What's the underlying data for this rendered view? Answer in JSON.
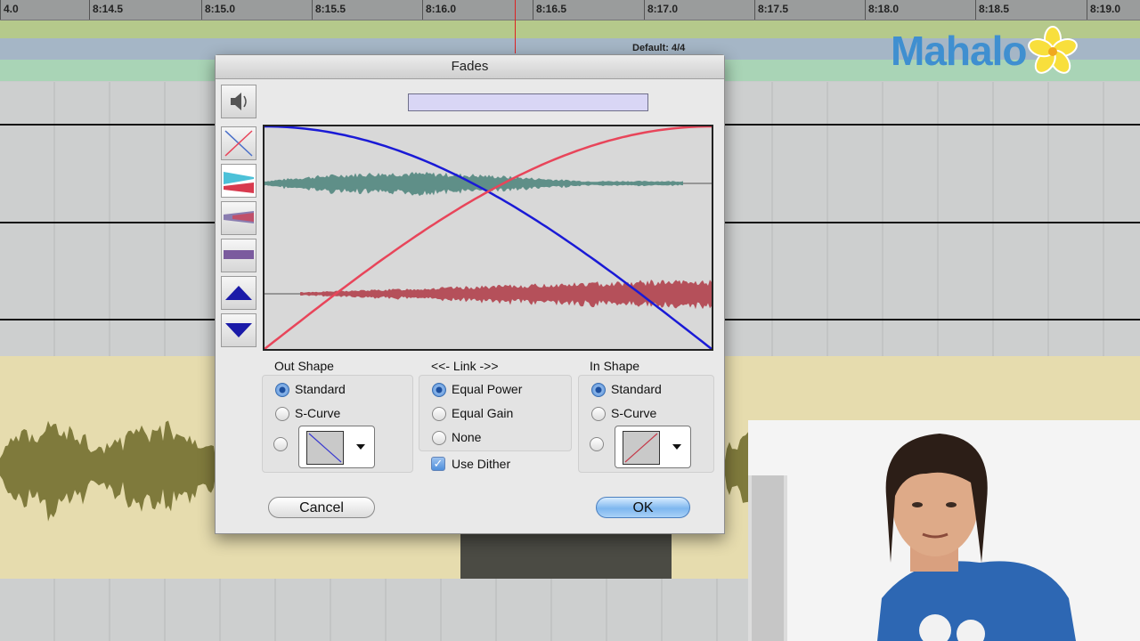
{
  "timeline": {
    "ticks": [
      "4.0",
      "8:14.5",
      "8:15.0",
      "8:15.5",
      "8:16.0",
      "8:16.5",
      "8:17.0",
      "8:17.5",
      "8:18.0",
      "8:18.5",
      "8:19.0"
    ],
    "meter_text": "Default: 4/4"
  },
  "logo": {
    "text": "Mahalo"
  },
  "dialog": {
    "title": "Fades",
    "out_shape": {
      "heading": "Out Shape",
      "options": [
        "Standard",
        "S-Curve"
      ],
      "selected": "Standard"
    },
    "link": {
      "heading": "<<- Link ->>",
      "options": [
        "Equal Power",
        "Equal Gain",
        "None"
      ],
      "selected": "Equal Power"
    },
    "use_dither": {
      "label": "Use Dither",
      "checked": true
    },
    "in_shape": {
      "heading": "In Shape",
      "options": [
        "Standard",
        "S-Curve"
      ],
      "selected": "Standard"
    },
    "buttons": {
      "cancel": "Cancel",
      "ok": "OK"
    },
    "toolbar_icons": [
      "speaker-icon",
      "show-curves-icon",
      "show-waveforms-icon",
      "show-summed-icon",
      "show-dither-icon",
      "zoom-up-icon",
      "zoom-down-icon"
    ]
  },
  "colors": {
    "fade_out_curve": "#1a1ad6",
    "fade_in_curve": "#e8455a",
    "out_waveform": "#5f8f88",
    "in_waveform": "#b5505a",
    "audio_waveform": "#7f7a3c"
  }
}
